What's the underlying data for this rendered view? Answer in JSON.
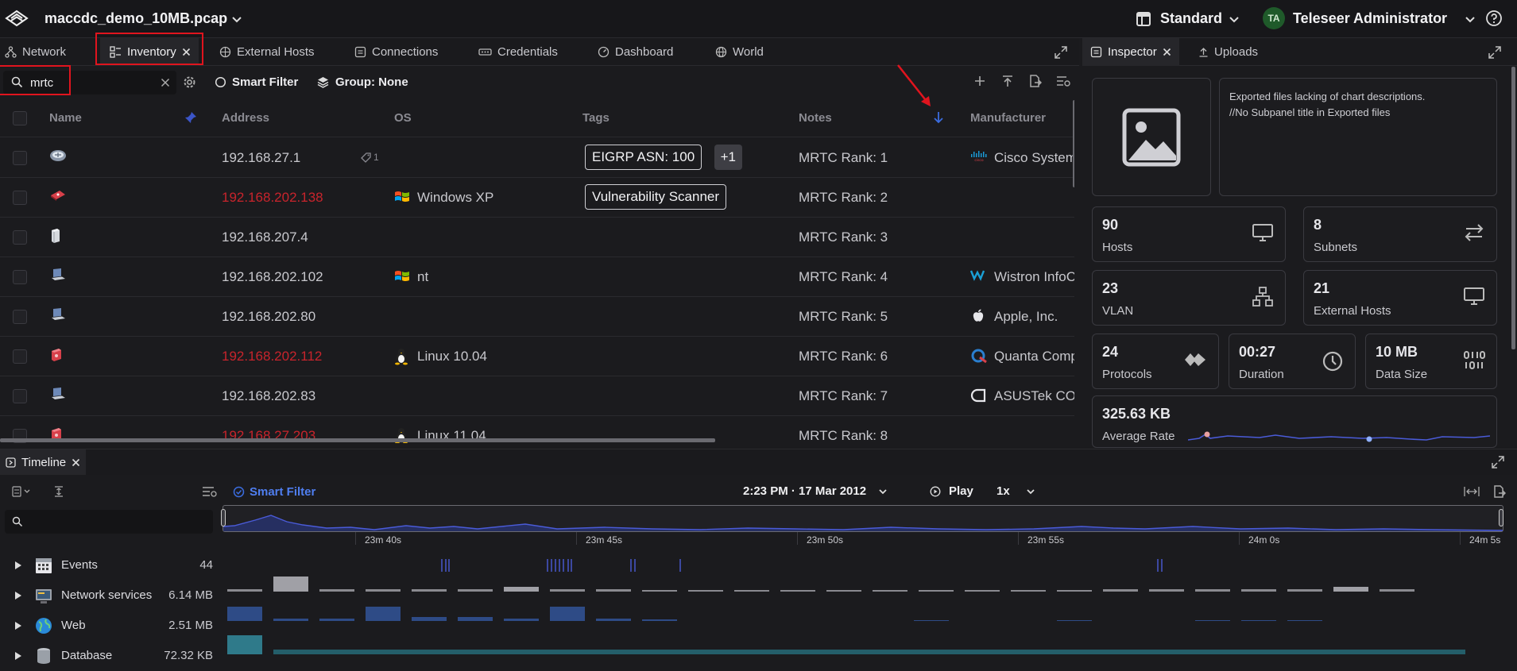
{
  "app": {
    "file_name": "maccdc_demo_10MB.pcap",
    "layout": "Standard",
    "user_initials": "TA",
    "user_name": "Teleseer Administrator"
  },
  "tabs": [
    {
      "label": "Network",
      "icon": "network-icon"
    },
    {
      "label": "Inventory",
      "icon": "inventory-icon",
      "active": true
    },
    {
      "label": "External Hosts",
      "icon": "external-hosts-icon"
    },
    {
      "label": "Connections",
      "icon": "connections-icon"
    },
    {
      "label": "Credentials",
      "icon": "credentials-icon"
    },
    {
      "label": "Dashboard",
      "icon": "dashboard-icon"
    },
    {
      "label": "World",
      "icon": "globe-icon"
    }
  ],
  "toolbar": {
    "search_value": "mrtc",
    "smart_filter": "Smart Filter",
    "group": "Group: None"
  },
  "table": {
    "columns": [
      "Name",
      "Address",
      "OS",
      "Tags",
      "Notes",
      "Manufacturer"
    ],
    "sort_indicator": "descending-arrow-icon",
    "rows": [
      {
        "icon": "router-icon",
        "address": "192.168.27.1",
        "address_flag": false,
        "attachments": "1",
        "os": "",
        "os_icon": "",
        "tags": [
          "EIGRP ASN: 100"
        ],
        "tag_more": "+1",
        "notes": "MRTC Rank: 1",
        "manufacturer": "Cisco Systems",
        "mfr_icon": "cisco-logo-icon"
      },
      {
        "icon": "scanner-device-icon",
        "address": "192.168.202.138",
        "address_flag": true,
        "attachments": "",
        "os": "Windows XP",
        "os_icon": "windows-logo-icon",
        "tags": [
          "Vulnerability Scanner"
        ],
        "tag_more": "",
        "notes": "MRTC Rank: 2",
        "manufacturer": "",
        "mfr_icon": ""
      },
      {
        "icon": "server-icon",
        "address": "192.168.207.4",
        "address_flag": false,
        "attachments": "",
        "os": "",
        "os_icon": "",
        "tags": [],
        "tag_more": "",
        "notes": "MRTC Rank: 3",
        "manufacturer": "",
        "mfr_icon": ""
      },
      {
        "icon": "laptop-icon",
        "address": "192.168.202.102",
        "address_flag": false,
        "attachments": "",
        "os": "nt",
        "os_icon": "windows-logo-icon",
        "tags": [],
        "tag_more": "",
        "notes": "MRTC Rank: 4",
        "manufacturer": "Wistron InfoComm",
        "mfr_icon": "wistron-logo-icon"
      },
      {
        "icon": "laptop-icon",
        "address": "192.168.202.80",
        "address_flag": false,
        "attachments": "",
        "os": "",
        "os_icon": "",
        "tags": [],
        "tag_more": "",
        "notes": "MRTC Rank: 5",
        "manufacturer": "Apple, Inc.",
        "mfr_icon": "apple-logo-icon"
      },
      {
        "icon": "firewall-device-icon",
        "address": "192.168.202.112",
        "address_flag": true,
        "attachments": "",
        "os": "Linux 10.04",
        "os_icon": "linux-penguin-icon",
        "tags": [],
        "tag_more": "",
        "notes": "MRTC Rank: 6",
        "manufacturer": "Quanta Computer",
        "mfr_icon": "quanta-logo-icon"
      },
      {
        "icon": "laptop-icon",
        "address": "192.168.202.83",
        "address_flag": false,
        "attachments": "",
        "os": "",
        "os_icon": "",
        "tags": [],
        "tag_more": "",
        "notes": "MRTC Rank: 7",
        "manufacturer": "ASUSTek COMPUTER",
        "mfr_icon": "asus-logo-icon"
      },
      {
        "icon": "firewall-device-icon",
        "address": "192.168.27.203",
        "address_flag": true,
        "attachments": "",
        "os": "Linux 11.04",
        "os_icon": "linux-penguin-icon",
        "tags": [],
        "tag_more": "",
        "notes": "MRTC Rank: 8",
        "manufacturer": "",
        "mfr_icon": ""
      }
    ]
  },
  "inspector": {
    "tabs": [
      {
        "label": "Inspector"
      },
      {
        "label": "Uploads"
      }
    ],
    "description": "Exported files lacking of chart descriptions.\n//No Subpanel title in Exported files",
    "stats": [
      {
        "value": "90",
        "label": "Hosts",
        "icon": "monitor-icon"
      },
      {
        "value": "8",
        "label": "Subnets",
        "icon": "swap-arrows-icon"
      },
      {
        "value": "23",
        "label": "VLAN",
        "icon": "hierarchy-icon"
      },
      {
        "value": "21",
        "label": "External Hosts",
        "icon": "monitor-icon"
      },
      {
        "value": "24",
        "label": "Protocols",
        "icon": "protocols-icon"
      },
      {
        "value": "00:27",
        "label": "Duration",
        "icon": "clock-icon"
      },
      {
        "value": "10 MB",
        "label": "Data Size",
        "icon": "binary-icon"
      }
    ],
    "average_rate": {
      "value": "325.63 KB",
      "label": "Average Rate"
    }
  },
  "timeline": {
    "title": "Timeline",
    "smart_filter": "Smart Filter",
    "datetime": "2:23 PM · 17 Mar 2012",
    "play": "Play",
    "speed": "1x",
    "ticks": [
      "23m 40s",
      "23m 45s",
      "23m 50s",
      "23m 55s",
      "24m 0s",
      "24m 5s"
    ],
    "events": [
      {
        "label": "Events",
        "value": "44",
        "icon": "calendar-icon"
      },
      {
        "label": "Network services",
        "value": "6.14 MB",
        "icon": "network-services-icon"
      },
      {
        "label": "Web",
        "value": "2.51 MB",
        "icon": "globe-icon"
      },
      {
        "label": "Database",
        "value": "72.32 KB",
        "icon": "database-icon"
      }
    ]
  },
  "colors": {
    "accent": "#3b6de0",
    "alert": "#c8242c",
    "annotation": "#e0141e",
    "chart_line": "#4a5bd8"
  }
}
